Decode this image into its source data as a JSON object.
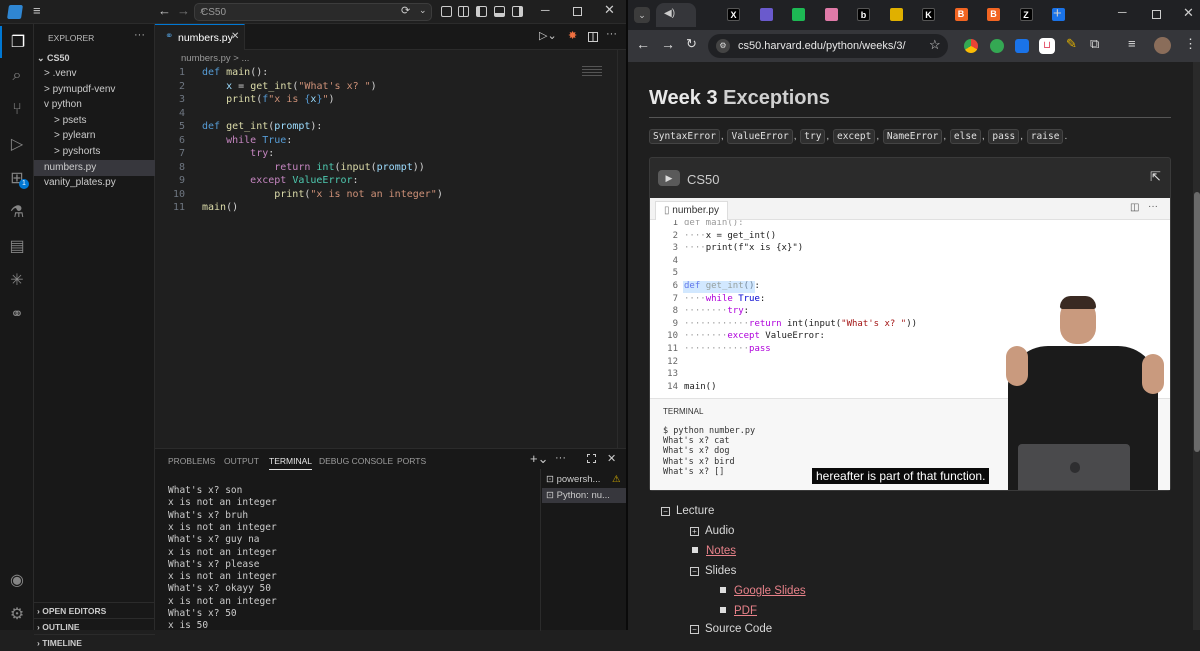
{
  "vscode": {
    "search_text": "CS50",
    "explorer_title": "EXPLORER",
    "project": "CS50",
    "tree": [
      {
        "label": "> .venv",
        "indent": 1
      },
      {
        "label": "> pymupdf-venv",
        "indent": 1
      },
      {
        "label": "v python",
        "indent": 1
      },
      {
        "label": "> psets",
        "indent": 2
      },
      {
        "label": "> pylearn",
        "indent": 2
      },
      {
        "label": "> pyshorts",
        "indent": 2
      },
      {
        "label": "numbers.py",
        "indent": 1
      },
      {
        "label": "vanity_plates.py",
        "indent": 1
      }
    ],
    "bottom_sections": [
      "OPEN EDITORS",
      "OUTLINE",
      "TIMELINE"
    ],
    "tab_label": "numbers.py",
    "breadcrumb": "numbers.py > ...",
    "code_lines": [
      {
        "n": "1",
        "html": "<span class='kw'>def</span> <span class='fn'>main</span><span class='plain'>():</span>"
      },
      {
        "n": "2",
        "html": "    <span class='var'>x</span> <span class='plain'>=</span> <span class='fn'>get_int</span><span class='plain'>(</span><span class='str'>\"What's x? \"</span><span class='plain'>)</span>"
      },
      {
        "n": "3",
        "html": "    <span class='fn'>print</span><span class='plain'>(</span><span class='kw'>f</span><span class='str'>\"x is </span><span class='kw'>{</span><span class='var'>x</span><span class='kw'>}</span><span class='str'>\"</span><span class='plain'>)</span>"
      },
      {
        "n": "4",
        "html": ""
      },
      {
        "n": "5",
        "html": "<span class='kw'>def</span> <span class='fn'>get_int</span><span class='plain'>(</span><span class='var'>prompt</span><span class='plain'>):</span>"
      },
      {
        "n": "6",
        "html": "    <span class='kw2'>while</span> <span class='kw'>True</span><span class='plain'>:</span>"
      },
      {
        "n": "7",
        "html": "        <span class='kw2'>try</span><span class='plain'>:</span>"
      },
      {
        "n": "8",
        "html": "            <span class='kw2'>return</span> <span class='cls'>int</span><span class='plain'>(</span><span class='fn'>input</span><span class='plain'>(</span><span class='var'>prompt</span><span class='plain'>))</span>"
      },
      {
        "n": "9",
        "html": "        <span class='kw2'>except</span> <span class='cls'>ValueError</span><span class='plain'>:</span>"
      },
      {
        "n": "10",
        "html": "            <span class='fn'>print</span><span class='plain'>(</span><span class='str'>\"x is not an integer\"</span><span class='plain'>)</span>"
      },
      {
        "n": "11",
        "html": "<span class='fn'>main</span><span class='plain'>()</span>"
      }
    ],
    "panel_tabs": [
      "PROBLEMS",
      "OUTPUT",
      "TERMINAL",
      "DEBUG CONSOLE",
      "PORTS"
    ],
    "active_panel_tab": "TERMINAL",
    "terminals": [
      "powersh...",
      "Python: nu..."
    ],
    "terminal_lines": [
      "What's x? son",
      "x is not an integer",
      "What's x? bruh",
      "x is not an integer",
      "What's x? guy na",
      "x is not an integer",
      "What's x? please",
      "x is not an integer",
      "What's x? okayy 50",
      "x is not an integer",
      "What's x? 50",
      "x is 50"
    ]
  },
  "chrome": {
    "url": "cs50.harvard.edu/python/weeks/3/",
    "tab_icons": [
      {
        "label": "X",
        "color": "#000000"
      },
      {
        "label": "",
        "color": "#6a5acd"
      },
      {
        "label": "",
        "color": "#1db954"
      },
      {
        "label": "",
        "color": "#e07aa8"
      },
      {
        "label": "b",
        "color": "#000000"
      },
      {
        "label": "",
        "color": "#e0b000"
      },
      {
        "label": "K",
        "color": "#000000"
      },
      {
        "label": "B",
        "color": "#f26522"
      },
      {
        "label": "B",
        "color": "#f26522"
      },
      {
        "label": "Z",
        "color": "#000000"
      },
      {
        "label": "",
        "color": "#1a73e8"
      }
    ],
    "heading_week": "Week 3",
    "heading_topic": "Exceptions",
    "keywords": [
      "SyntaxError",
      "ValueError",
      "try",
      "except",
      "NameError",
      "else",
      "pass",
      "raise"
    ],
    "video_channel": "CS50",
    "video_file_tab": "number.py",
    "video_code_lines": [
      {
        "n": "1",
        "html": "<span class='vd'>def main():</span>"
      },
      {
        "n": "2",
        "html": "<span class='vd'>····</span>x = get_int()"
      },
      {
        "n": "3",
        "html": "<span class='vd'>····</span>print(f\"x is {x}\")"
      },
      {
        "n": "4",
        "html": ""
      },
      {
        "n": "5",
        "html": ""
      },
      {
        "n": "6",
        "html": "<span class='vk'>def</span> <span class='vf'>get_int</span>():"
      },
      {
        "n": "7",
        "html": "<span class='vd'>····</span><span class='vk2'>while</span> <span class='vk'>True</span>:"
      },
      {
        "n": "8",
        "html": "<span class='vd'>········</span><span class='vk2'>try</span>:"
      },
      {
        "n": "9",
        "html": "<span class='vd'>············</span><span class='vk2'>return</span> int(input(<span class='vs'>\"What's x? \"</span>))"
      },
      {
        "n": "10",
        "html": "<span class='vd'>········</span><span class='vk2'>except</span> ValueError:"
      },
      {
        "n": "11",
        "html": "<span class='vd'>············</span><span class='vk2'>pass</span>"
      },
      {
        "n": "12",
        "html": ""
      },
      {
        "n": "13",
        "html": ""
      },
      {
        "n": "14",
        "html": "main()"
      }
    ],
    "video_terminal_label": "TERMINAL",
    "video_terminal_lines": [
      "$ python number.py",
      "What's x? cat",
      "What's x? dog",
      "What's x? bird",
      "What's x? []"
    ],
    "caption": "hereafter is part of that function.",
    "lecture": {
      "title": "Lecture",
      "audio": "Audio",
      "notes": "Notes",
      "slides": "Slides",
      "google_slides": "Google Slides",
      "pdf": "PDF",
      "source_code": "Source Code"
    }
  }
}
